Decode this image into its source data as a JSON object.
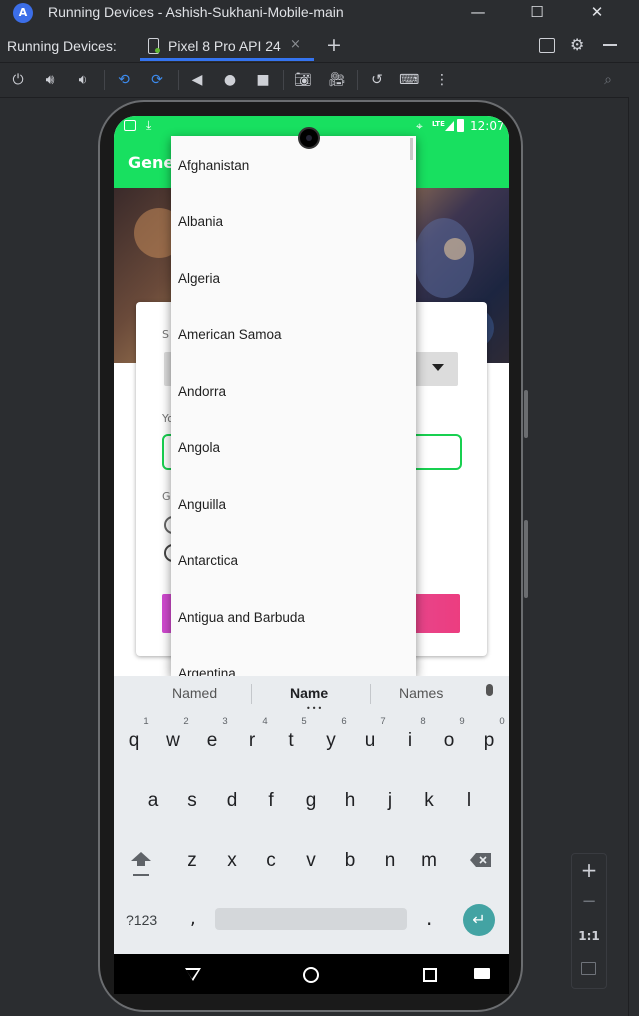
{
  "window": {
    "title": "Running Devices - Ashish-Sukhani-Mobile-main",
    "controls": [
      "minimize-icon",
      "maximize-icon",
      "close-icon"
    ]
  },
  "tool_window": {
    "label": "Running Devices:",
    "tab_label": "Pixel 8 Pro API 24",
    "tab_close": "×",
    "add_tab": "+"
  },
  "toolbar": {
    "icons": [
      "power-icon",
      "volume-up-icon",
      "volume-down-icon",
      "rotate-left-icon",
      "rotate-right-icon",
      "back-icon",
      "home-icon",
      "overview-icon",
      "screenshot-icon",
      "screen-record-icon",
      "reset-icon",
      "keyboard-icon",
      "more-icon"
    ]
  },
  "phone": {
    "status_bar": {
      "time": "12:07",
      "network": "LTE"
    },
    "app_bar_title": "Gene",
    "form": {
      "country_label": "S",
      "your_label": "Yo",
      "your_value": "",
      "gender_label": "G",
      "gender_option_1": "(",
      "gender_option_2": "C"
    },
    "country_dropdown": {
      "options": [
        "Afghanistan",
        "Albania",
        "Algeria",
        "American Samoa",
        "Andorra",
        "Angola",
        "Anguilla",
        "Antarctica",
        "Antigua and Barbuda",
        "Argentina"
      ]
    },
    "keyboard": {
      "suggestions": [
        "Named",
        "Name",
        "Names"
      ],
      "row1": [
        "q",
        "w",
        "e",
        "r",
        "t",
        "y",
        "u",
        "i",
        "o",
        "p"
      ],
      "row1_numbers": [
        "1",
        "2",
        "3",
        "4",
        "5",
        "6",
        "7",
        "8",
        "9",
        "0"
      ],
      "row2": [
        "a",
        "s",
        "d",
        "f",
        "g",
        "h",
        "j",
        "k",
        "l"
      ],
      "row3": [
        "z",
        "x",
        "c",
        "v",
        "b",
        "n",
        "m"
      ],
      "symbols_key": "?123",
      "comma_key": ",",
      "period_key": "."
    }
  },
  "zoom_controls": {
    "zoom_in": "+",
    "zoom_out": "−",
    "actual_size": "1:1"
  },
  "colors": {
    "app_green": "#18e060",
    "ide_background": "#2b2d30",
    "accent_blue": "#3574f0",
    "enter_key": "#43a3a3"
  }
}
